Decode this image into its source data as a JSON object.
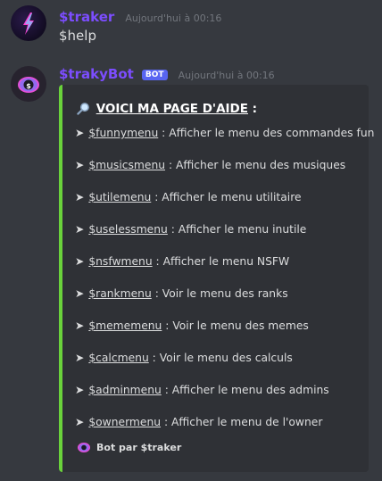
{
  "messages": [
    {
      "username": "$traker",
      "username_color": "#7c4dff",
      "timestamp": "Aujourd'hui à 00:16",
      "text": "$help"
    },
    {
      "username": "$trakyBot",
      "username_color": "#7c4dff",
      "bot_tag": "BOT",
      "timestamp": "Aujourd'hui à 00:16",
      "embed": {
        "accent_color": "#6ad23b",
        "title_icon": "magnifying-glass-icon",
        "title": "VOICI MA PAGE D'AIDE",
        "title_suffix": " :",
        "items": [
          {
            "command": "$funnymenu",
            "desc": " : Afficher le menu des commandes fun"
          },
          {
            "command": "$musicsmenu",
            "desc": " : Afficher le menu des musiques"
          },
          {
            "command": "$utilemenu",
            "desc": " : Afficher le menu utilitaire"
          },
          {
            "command": "$uselessmenu",
            "desc": " : Afficher le menu inutile"
          },
          {
            "command": "$nsfwmenu",
            "desc": " : Afficher le menu NSFW"
          },
          {
            "command": "$rankmenu",
            "desc": " : Voir le menu des ranks"
          },
          {
            "command": "$mememenu",
            "desc": " : Voir le menu des memes"
          },
          {
            "command": "$calcmenu",
            "desc": " : Voir le menu des calculs"
          },
          {
            "command": "$adminmenu",
            "desc": " : Afficher le menu des admins"
          },
          {
            "command": "$ownermenu",
            "desc": " : Afficher le menu de l'owner"
          }
        ],
        "footer": "Bot par $traker"
      }
    }
  ]
}
